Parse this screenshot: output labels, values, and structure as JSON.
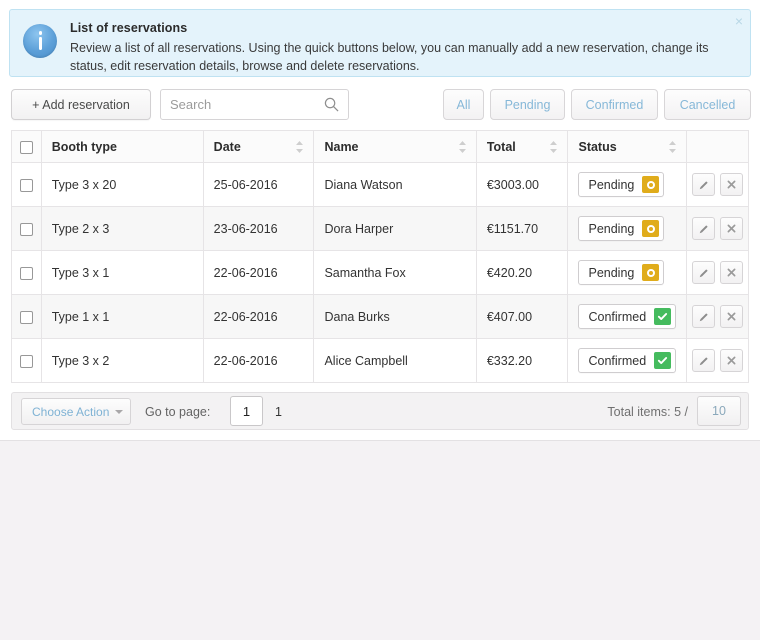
{
  "banner": {
    "title": "List of reservations",
    "text": "Review a list of all reservations. Using the quick buttons below, you can manually add a new reservation, change its status, edit reservation details, browse and delete reservations.",
    "close_label": "×",
    "icon": "info-icon",
    "bg_color": "#e4f3fb",
    "border_color": "#bfe2f2",
    "icon_color": "#5c9fd8"
  },
  "toolbar": {
    "add_label": "+ Add reservation",
    "search_placeholder": "Search",
    "search_value": "",
    "search_icon": "magnifier-icon",
    "filters": [
      {
        "label": "All"
      },
      {
        "label": "Pending"
      },
      {
        "label": "Confirmed"
      },
      {
        "label": "Cancelled"
      }
    ],
    "filter_text_color": "#86b8d8"
  },
  "table": {
    "headers": [
      {
        "label": "Booth type",
        "sortable": false
      },
      {
        "label": "Date",
        "sortable": true
      },
      {
        "label": "Name",
        "sortable": true
      },
      {
        "label": "Total",
        "sortable": true
      },
      {
        "label": "Status",
        "sortable": true
      }
    ],
    "rows": [
      {
        "booth": "Type 3 x 20",
        "date": "25-06-2016",
        "name": "Diana Watson",
        "total": "€3003.00",
        "status": "Pending",
        "status_kind": "pending"
      },
      {
        "booth": "Type 2 x 3",
        "date": "23-06-2016",
        "name": "Dora Harper",
        "total": "€1151.70",
        "status": "Pending",
        "status_kind": "pending"
      },
      {
        "booth": "Type 3 x 1",
        "date": "22-06-2016",
        "name": "Samantha Fox",
        "total": "€420.20",
        "status": "Pending",
        "status_kind": "pending"
      },
      {
        "booth": "Type 1 x 1",
        "date": "22-06-2016",
        "name": "Dana Burks",
        "total": "€407.00",
        "status": "Confirmed",
        "status_kind": "confirmed"
      },
      {
        "booth": "Type 3 x 2",
        "date": "22-06-2016",
        "name": "Alice Campbell",
        "total": "€332.20",
        "status": "Confirmed",
        "status_kind": "confirmed"
      }
    ],
    "status_colors": {
      "pending": "#e0ac1b",
      "confirmed": "#45bb5e",
      "cancelled": "#d9534f"
    },
    "edit_icon": "pencil-icon",
    "delete_icon": "close-x-icon"
  },
  "footer": {
    "choose_action_label": "Choose Action",
    "goto_label": "Go to page:",
    "goto_value": "1",
    "current_page": "1",
    "total_label": "Total items: 5 /",
    "per_page": "10"
  }
}
